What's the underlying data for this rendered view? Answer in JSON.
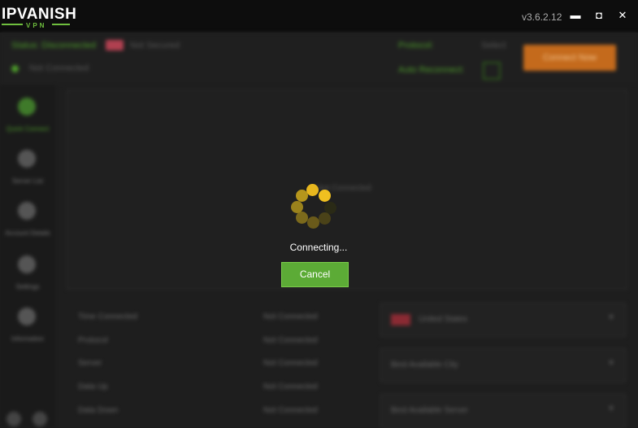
{
  "window": {
    "logo_main": "IPVANISH",
    "logo_sub": "VPN",
    "version": "v3.6.2.12",
    "minimize_glyph": "▬",
    "maximize_glyph": "◘",
    "close_glyph": "✕"
  },
  "topbar": {
    "status_label": "Status: Disconnected",
    "status_badge": "",
    "status_sub": "Not Secured",
    "ip_label": "Not Connected",
    "protocol_label": "Protocol:",
    "protocol_value": "Select",
    "auto_reconnect_label": "Auto Reconnect:",
    "connect_label": "Connect Now"
  },
  "sidebar": {
    "items": [
      {
        "label": "Quick Connect",
        "icon": "quick-connect-icon"
      },
      {
        "label": "Server List",
        "icon": "server-list-icon"
      },
      {
        "label": "Account Details",
        "icon": "account-icon"
      },
      {
        "label": "Settings",
        "icon": "settings-icon"
      },
      {
        "label": "Information",
        "icon": "info-icon"
      }
    ]
  },
  "panel": {
    "text": "Not Connected"
  },
  "info_table": {
    "rows": [
      {
        "key": "Time Connected",
        "value": "Not Connected"
      },
      {
        "key": "Protocol",
        "value": "Not Connected"
      },
      {
        "key": "Server",
        "value": "Not Connected"
      },
      {
        "key": "Data Up",
        "value": "Not Connected"
      },
      {
        "key": "Data Down",
        "value": "Not Connected"
      }
    ]
  },
  "locations": {
    "country": "United States",
    "city": "Best Available City",
    "server": "Best Available Server"
  },
  "dialog": {
    "status_text": "Connecting...",
    "cancel_label": "Cancel"
  },
  "colors": {
    "accent_green": "#5cab36",
    "accent_orange": "#c46a1c",
    "spinner": "#e8b71e"
  }
}
